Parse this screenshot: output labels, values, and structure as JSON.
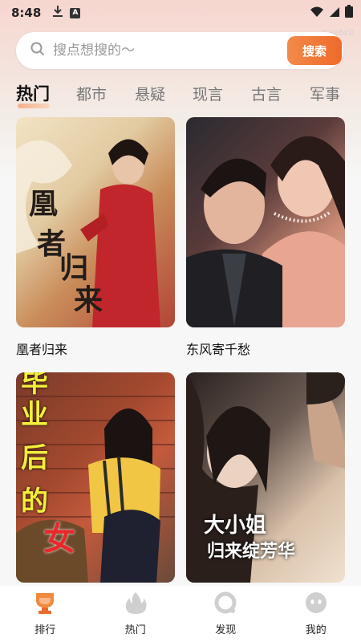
{
  "status_bar": {
    "time": "8:48",
    "tag": "A"
  },
  "corner_code": "cae6c0",
  "search": {
    "placeholder": "搜点想搜的～",
    "button_label": "搜索"
  },
  "tabs": [
    {
      "label": "热门",
      "active": true
    },
    {
      "label": "都市"
    },
    {
      "label": "悬疑"
    },
    {
      "label": "现言"
    },
    {
      "label": "古言"
    },
    {
      "label": "军事"
    }
  ],
  "dramas": [
    {
      "title": "凰者归来",
      "cover_text": [
        "凰",
        "者",
        "归",
        "来"
      ]
    },
    {
      "title": "东风寄千愁"
    },
    {
      "title": "",
      "cover_text": [
        "毕",
        "业",
        "后",
        "的",
        "女"
      ]
    },
    {
      "title": "",
      "cover_text": [
        "大小姐",
        "归来绽芳华"
      ]
    }
  ],
  "nav": [
    {
      "label": "排行",
      "icon": "trophy-icon",
      "active": true
    },
    {
      "label": "热门",
      "icon": "flame-icon"
    },
    {
      "label": "发现",
      "icon": "discover-icon"
    },
    {
      "label": "我的",
      "icon": "profile-icon"
    }
  ]
}
